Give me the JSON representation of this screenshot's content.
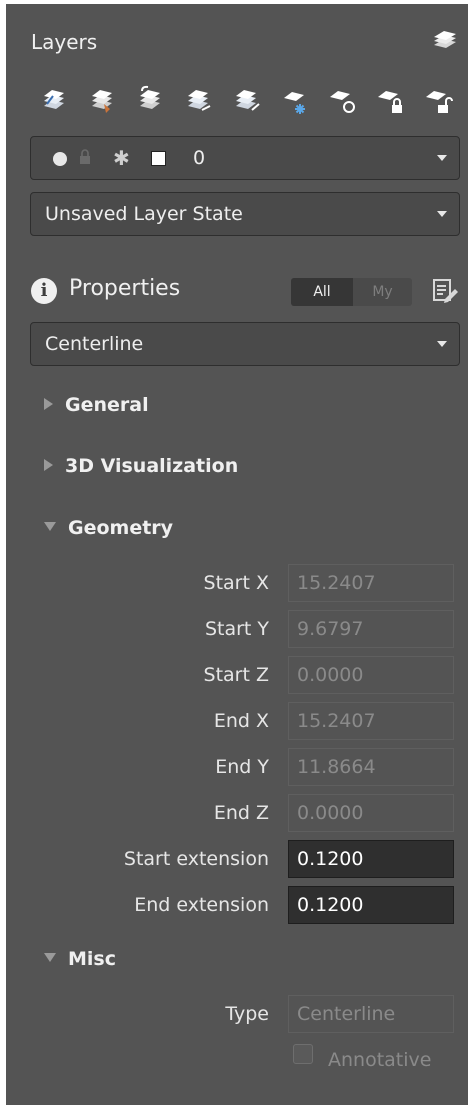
{
  "layers": {
    "title": "Layers",
    "icons": [
      "layer-manager-icon",
      "layer-match-icon",
      "layer-previous-icon",
      "layer-isolate-icon",
      "layer-unisolate-icon",
      "layer-freeze-icon",
      "layer-off-icon",
      "layer-lock-icon",
      "layer-unlock-icon"
    ],
    "current_layer": {
      "name": "0"
    },
    "layer_state": "Unsaved Layer State"
  },
  "properties": {
    "title": "Properties",
    "toggle": {
      "all_label": "All",
      "my_label": "My"
    },
    "selection": "Centerline",
    "sections": {
      "general": "General",
      "visualization": "3D Visualization",
      "geometry": "Geometry",
      "misc": "Misc"
    },
    "geometry": [
      {
        "label": "Start X",
        "value": "15.2407",
        "editable": false
      },
      {
        "label": "Start Y",
        "value": "9.6797",
        "editable": false
      },
      {
        "label": "Start Z",
        "value": "0.0000",
        "editable": false
      },
      {
        "label": "End X",
        "value": "15.2407",
        "editable": false
      },
      {
        "label": "End Y",
        "value": "11.8664",
        "editable": false
      },
      {
        "label": "End Z",
        "value": "0.0000",
        "editable": false
      },
      {
        "label": "Start extension",
        "value": "0.1200",
        "editable": true
      },
      {
        "label": "End extension",
        "value": "0.1200",
        "editable": true
      }
    ],
    "misc": {
      "type_label": "Type",
      "type_value": "Centerline",
      "annotative_label": "Annotative",
      "annotative_checked": false
    }
  },
  "colors": {
    "panel_bg": "#545454",
    "field_dark": "#2f2f2f",
    "text": "#e8e8e8",
    "disabled_text": "#8a8a8a"
  }
}
